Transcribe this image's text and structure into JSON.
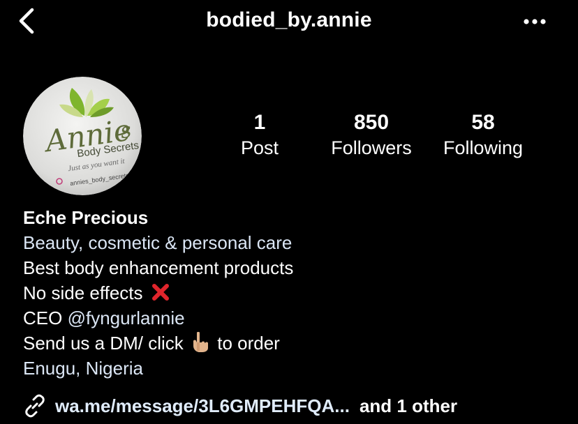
{
  "header": {
    "username": "bodied_by.annie",
    "back_icon": "chevron-left-icon",
    "more_icon": "more-horizontal-icon"
  },
  "avatar": {
    "logo_main": "Annie",
    "logo_s": "s",
    "logo_sub": "Body Secrets",
    "logo_tagline": "Just as you want it",
    "logo_handle": "annies_body_secrets",
    "accent": "#8cc83c"
  },
  "stats": {
    "posts": {
      "count": "1",
      "label": "Post"
    },
    "followers": {
      "count": "850",
      "label": "Followers"
    },
    "following": {
      "count": "58",
      "label": "Following"
    }
  },
  "bio": {
    "name": "Eche Precious",
    "category": "Beauty, cosmetic & personal care",
    "line1": "Best body enhancement products",
    "line2": "No side effects",
    "line2_emoji": "cross-mark-icon",
    "line3_prefix": "CEO ",
    "line3_mention": "@fyngurlannie",
    "line4_prefix": "Send us a DM/ click",
    "line4_emoji": "pointing-down-hand-icon",
    "line4_suffix": "to order",
    "location": "Enugu, Nigeria"
  },
  "link": {
    "icon": "link-icon",
    "text": "wa.me/message/3L6GMPEHFQA...",
    "more": "and 1 other"
  },
  "colors": {
    "background": "#000000",
    "text": "#ffffff",
    "link": "#e0ecfb",
    "cross": "#e0252c"
  }
}
